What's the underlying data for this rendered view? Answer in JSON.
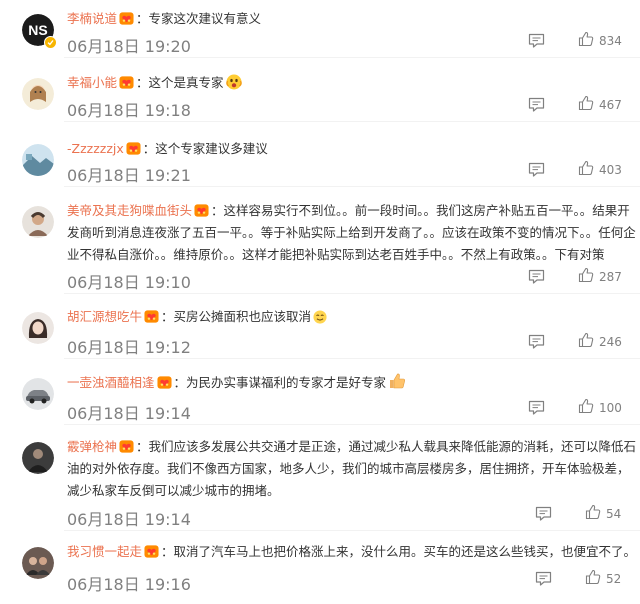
{
  "comments": [
    {
      "user": "李楠说道",
      "text": "专家这次建议有意义",
      "time": "06月18日 19:20",
      "likes": "834",
      "emoji": "",
      "verified": true,
      "avatar": "ns-logo"
    },
    {
      "user": "幸福小能",
      "text": "这个是真专家",
      "time": "06月18日 19:18",
      "likes": "467",
      "emoji": "surprised-face-emoji",
      "verified": false,
      "avatar": "cartoon-girl"
    },
    {
      "user": "-Zzzzzzjx",
      "text": "这个专家建议多建议",
      "time": "06月18日 19:21",
      "likes": "403",
      "emoji": "",
      "verified": false,
      "avatar": "landscape"
    },
    {
      "user": "美帝及其走狗喋血街头",
      "text": "这样容易实行不到位。。前一段时间。。我们这房产补贴五百一平。。结果开发商听到消息连夜涨了五百一平。。等于补贴实际上给到开发商了。。应该在政策不变的情况下。。任何企业不得私自涨价。。维持原价。。这样才能把补贴实际到达老百姓手中。。不然上有政策。。下有对策",
      "time": "06月18日 19:10",
      "likes": "287",
      "emoji": "",
      "verified": false,
      "avatar": "person-photo"
    },
    {
      "user": "胡汇源想吃牛",
      "text": "买房公摊面积也应该取消",
      "time": "06月18日 19:12",
      "likes": "246",
      "emoji": "smile-emoji",
      "verified": false,
      "avatar": "girl-photo"
    },
    {
      "user": "一壶浊酒醯相逢",
      "text": "为民办实事谋福利的专家才是好专家",
      "time": "06月18日 19:14",
      "likes": "100",
      "emoji": "thumbs-up-emoji",
      "verified": false,
      "avatar": "car-photo"
    },
    {
      "user": "霰弹枪神",
      "text": "我们应该多发展公共交通才是正途，通过减少私人载具来降低能源的消耗，还可以降低石油的对外依存度。我们不像西方国家，地多人少，我们的城市高层楼房多，居住拥挤，开车体验极差，减少私家车反倒可以减少城市的拥堵。",
      "time": "06月18日 19:14",
      "likes": "54",
      "emoji": "",
      "verified": false,
      "avatar": "dark-figure"
    },
    {
      "user": "我习惯一起走",
      "text": "取消了汽车马上也把价格涨上来，没什么用。买车的还是这么些钱买，也便宜不了。",
      "time": "06月18日 19:16",
      "likes": "52",
      "emoji": "",
      "verified": false,
      "avatar": "group-photo"
    }
  ],
  "colors": {
    "username": "#eb7350",
    "text": "#333333",
    "meta": "#808080"
  }
}
